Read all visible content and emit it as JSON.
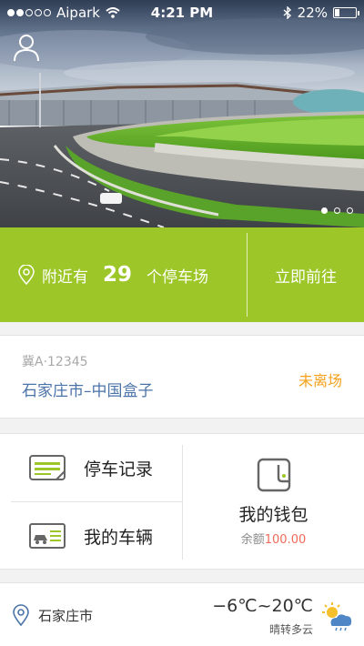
{
  "status_bar": {
    "carrier": "Aipark",
    "time": "4:21 PM",
    "battery": "22%",
    "battery_level": 0.22,
    "signal_bars": 2
  },
  "banner": {
    "active_slide": 1,
    "slide_count": 3
  },
  "nearby": {
    "prefix": "附近有",
    "count": "29",
    "suffix": "个停车场",
    "go_label": "立即前往"
  },
  "parking": {
    "plate": "冀A·12345",
    "location": "石家庄市–中国盒子",
    "status": "未离场"
  },
  "menu": {
    "records_label": "停车记录",
    "vehicles_label": "我的车辆",
    "wallet_label": "我的钱包",
    "balance_prefix": "余额",
    "balance_amount": "100.00"
  },
  "weather": {
    "city": "石家庄市",
    "temperature": "−6℃~20℃",
    "condition": "晴转多云"
  },
  "colors": {
    "accent_green": "#9dc728",
    "link_blue": "#4a73a8",
    "status_orange": "#f5a11c",
    "balance_red": "#f06a5a"
  },
  "icons": {
    "profile": "user-icon",
    "location": "location-pin-icon",
    "records": "parking-record-icon",
    "vehicles": "vehicle-card-icon",
    "wallet": "wallet-icon",
    "weather": "partly-cloudy-icon"
  }
}
